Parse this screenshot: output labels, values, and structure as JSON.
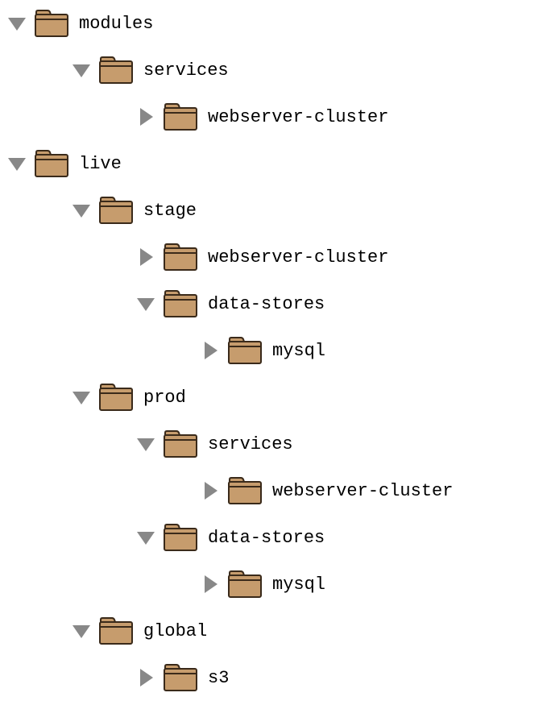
{
  "tree": [
    {
      "level": 0,
      "expanded": true,
      "label": "modules"
    },
    {
      "level": 1,
      "expanded": true,
      "label": "services"
    },
    {
      "level": 2,
      "expanded": false,
      "label": "webserver-cluster"
    },
    {
      "level": 0,
      "expanded": true,
      "label": "live"
    },
    {
      "level": 1,
      "expanded": true,
      "label": "stage"
    },
    {
      "level": 2,
      "expanded": false,
      "label": "webserver-cluster"
    },
    {
      "level": 2,
      "expanded": true,
      "label": "data-stores"
    },
    {
      "level": 3,
      "expanded": false,
      "label": "mysql"
    },
    {
      "level": 1,
      "expanded": true,
      "label": "prod"
    },
    {
      "level": 2,
      "expanded": true,
      "label": "services"
    },
    {
      "level": 3,
      "expanded": false,
      "label": "webserver-cluster"
    },
    {
      "level": 2,
      "expanded": true,
      "label": "data-stores"
    },
    {
      "level": 3,
      "expanded": false,
      "label": "mysql"
    },
    {
      "level": 1,
      "expanded": true,
      "label": "global"
    },
    {
      "level": 2,
      "expanded": false,
      "label": "s3"
    }
  ],
  "colors": {
    "folder_fill": "#c69c6d",
    "folder_stroke": "#3a2a1a",
    "triangle_fill": "#888888"
  }
}
